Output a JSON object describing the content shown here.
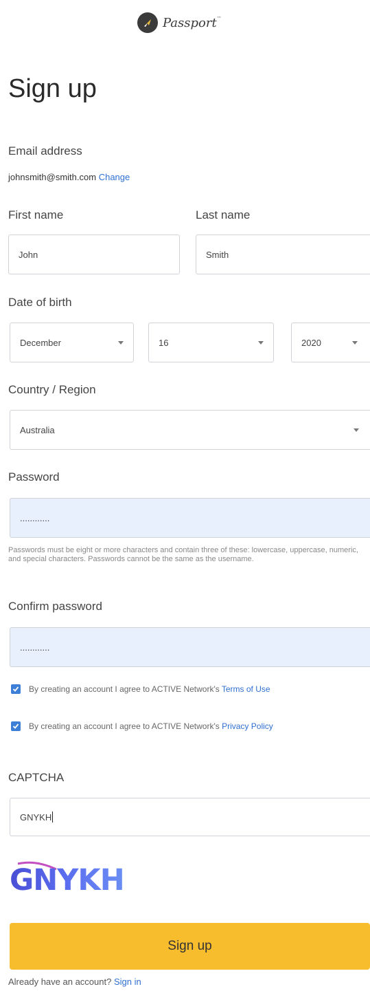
{
  "brand": {
    "name": "Passport",
    "tm": "™"
  },
  "page_title": "Sign up",
  "email": {
    "label": "Email address",
    "value": "johnsmith@smith.com",
    "change_link": "Change"
  },
  "first_name": {
    "label": "First name",
    "value": "John"
  },
  "last_name": {
    "label": "Last name",
    "value": "Smith"
  },
  "dob": {
    "label": "Date of birth",
    "month": "December",
    "day": "16",
    "year": "2020"
  },
  "country": {
    "label": "Country / Region",
    "value": "Australia"
  },
  "password": {
    "label": "Password",
    "value": "............",
    "hint": "Passwords must be eight or more characters and contain three of these: lowercase, uppercase, numeric, and special characters. Passwords cannot be the same as the username."
  },
  "confirm_password": {
    "label": "Confirm password",
    "value": "............"
  },
  "agreements": [
    {
      "text": "By creating an account I agree to ACTIVE Network's ",
      "link": "Terms of Use",
      "checked": true
    },
    {
      "text": "By creating an account I agree to ACTIVE Network's ",
      "link": "Privacy Policy",
      "checked": true
    }
  ],
  "captcha": {
    "label": "CAPTCHA",
    "input_value": "GNYKH",
    "image_text": "GNYKH"
  },
  "submit_label": "Sign up",
  "footer": {
    "text": "Already have an account?",
    "link": "Sign in"
  },
  "colors": {
    "accent": "#f7bd2c",
    "link": "#2f6fd1",
    "checkbox": "#3d7fd6",
    "autofill": "#e8f0fe"
  }
}
